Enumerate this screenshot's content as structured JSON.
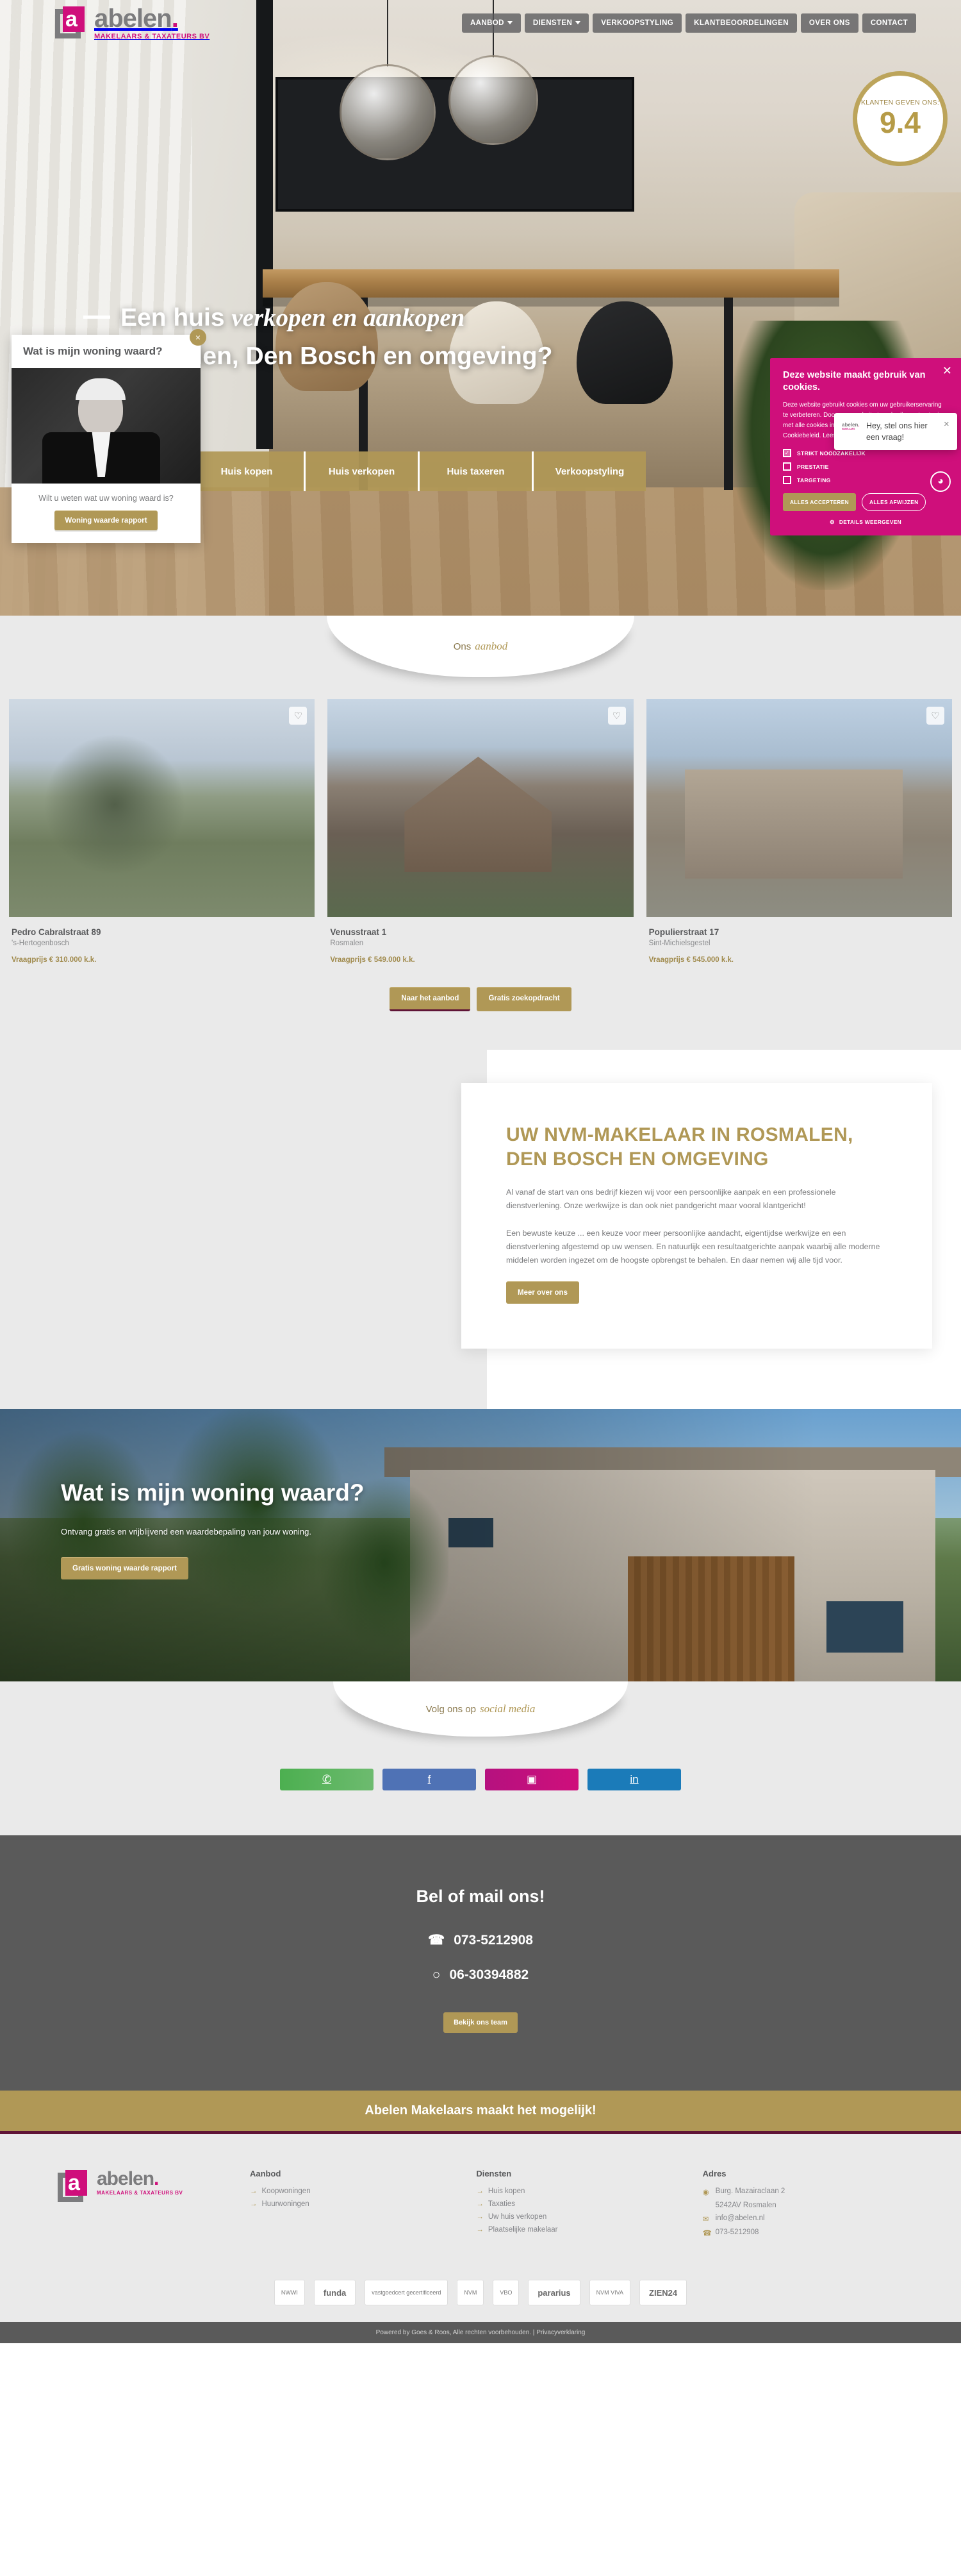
{
  "brand": {
    "name": "abelen",
    "dot": ".",
    "tagline": "MAKELAARS & TAXATEURS BV",
    "letter": "a",
    "colors": {
      "pink": "#cf0f7b",
      "gold": "#b09856",
      "grey": "#58595b",
      "dark_grey": "#5a5a5a",
      "wine": "#5f1436"
    }
  },
  "nav": {
    "items": [
      {
        "label": "AANBOD",
        "has_caret": true
      },
      {
        "label": "DIENSTEN",
        "has_caret": true
      },
      {
        "label": "VERKOOPSTYLING",
        "has_caret": false
      },
      {
        "label": "KLANTBEOORDELINGEN",
        "has_caret": false
      },
      {
        "label": "OVER ONS",
        "has_caret": false
      },
      {
        "label": "CONTACT",
        "has_caret": false
      }
    ]
  },
  "score_badge": {
    "label": "KLANTEN GEVEN ONS:",
    "value": "9.4"
  },
  "hero": {
    "line1_plain": "Een huis ",
    "line1_script": "verkopen en aankopen",
    "line2": "in Rosmalen, Den Bosch en omgeving?",
    "tabs": [
      {
        "label": "Huis kopen"
      },
      {
        "label": "Huis verkopen"
      },
      {
        "label": "Huis taxeren"
      },
      {
        "label": "Verkoopstyling"
      }
    ]
  },
  "value_card": {
    "heading": "Wat is mijn woning waard?",
    "question": "Wilt u weten wat uw woning waard is?",
    "button": "Woning waarde rapport",
    "close_icon": "×"
  },
  "cookie": {
    "title": "Deze website maakt gebruik van cookies.",
    "body": "Deze website gebruikt cookies om uw gebruikerservaring te verbeteren. Door onze website te gebruiken, stemt u in met alle cookies in overeenstemming met ons Cookiebeleid. Lees verder",
    "options": [
      {
        "label": "STRIKT NOODZAKELIJK",
        "checked": true
      },
      {
        "label": "PRESTATIE",
        "checked": false
      },
      {
        "label": "TARGETING",
        "checked": false
      }
    ],
    "accept": "ALLES ACCEPTEREN",
    "reject": "ALLES AFWIJZEN",
    "details": "DETAILS WEERGEVEN",
    "close_icon": "✕"
  },
  "chat": {
    "message": "Hey, stel ons hier een vraag!",
    "close_icon": "✕"
  },
  "offer": {
    "ribbon_plain": "Ons",
    "ribbon_script": "aanbod",
    "listings": [
      {
        "title": "Pedro Cabralstraat 89",
        "city": "'s-Hertogenbosch",
        "price": "Vraagprijs € 310.000 k.k."
      },
      {
        "title": "Venusstraat 1",
        "city": "Rosmalen",
        "price": "Vraagprijs € 549.000 k.k."
      },
      {
        "title": "Populierstraat 17",
        "city": "Sint-Michielsgestel",
        "price": "Vraagprijs € 545.000 k.k."
      }
    ],
    "buttons": [
      {
        "label": "Naar het aanbod"
      },
      {
        "label": "Gratis zoekopdracht"
      }
    ],
    "favorite_icon": "♡"
  },
  "about": {
    "heading": "UW NVM-MAKELAAR IN ROSMALEN, DEN BOSCH EN OMGEVING",
    "paragraph1": "Al vanaf de start van ons bedrijf kiezen wij voor een persoonlijke aanpak en een professionele dienstverlening. Onze werkwijze is dan ook niet pandgericht maar vooral klantgericht!",
    "paragraph2": "Een bewuste keuze ... een keuze voor meer persoonlijke aandacht, eigentijdse werkwijze en een dienstverlening afgestemd op uw wensen. En natuurlijk een resultaatgerichte aanpak waarbij alle moderne middelen worden ingezet om de hoogste opbrengst te behalen. En daar nemen wij alle tijd voor.",
    "button": "Meer over ons"
  },
  "value_banner": {
    "heading": "Wat is mijn woning waard?",
    "subtitle": "Ontvang gratis en vrijblijvend een waardebepaling van jouw woning.",
    "button": "Gratis woning waarde rapport"
  },
  "social": {
    "ribbon_plain": "Volg ons op",
    "ribbon_script": "social media",
    "items": [
      {
        "name": "whatsapp",
        "icon": "✆"
      },
      {
        "name": "facebook",
        "icon": "f"
      },
      {
        "name": "instagram",
        "icon": "▣"
      },
      {
        "name": "linkedin",
        "icon": "in"
      }
    ]
  },
  "contact": {
    "heading": "Bel of mail ons!",
    "phone": "073-5212908",
    "whatsapp": "06-30394882",
    "phone_icon": "☎",
    "whatsapp_icon": "○",
    "button": "Bekijk ons team"
  },
  "strip": {
    "text": "Abelen Makelaars maakt het mogelijk!"
  },
  "footer": {
    "columns": [
      {
        "title": "Aanbod",
        "links": [
          {
            "label": "Koopwoningen"
          },
          {
            "label": "Huurwoningen"
          }
        ]
      },
      {
        "title": "Diensten",
        "links": [
          {
            "label": "Huis kopen"
          },
          {
            "label": "Taxaties"
          },
          {
            "label": "Uw huis verkopen"
          },
          {
            "label": "Plaatselijke makelaar"
          }
        ]
      }
    ],
    "address": {
      "title": "Adres",
      "street": "Burg. Mazairaclaan 2",
      "postal": "5242AV Rosmalen",
      "email": "info@abelen.nl",
      "phone": "073-5212908",
      "pin_icon": "◉",
      "mail_icon": "✉",
      "phone_icon": "☎"
    },
    "arrow_icon": "→",
    "brands": [
      {
        "label": "NWWI",
        "style": "sm"
      },
      {
        "label": "funda",
        "style": "lg"
      },
      {
        "label": "vastgoedcert gecertificeerd",
        "style": "sm"
      },
      {
        "label": "NVM",
        "style": "sm"
      },
      {
        "label": "VBO",
        "style": "sm"
      },
      {
        "label": "pararius",
        "style": "lg"
      },
      {
        "label": "NVM VIVA",
        "style": "sm"
      },
      {
        "label": "ZIEN24",
        "style": "lg"
      }
    ],
    "copyright": "Powered by Goes & Roos, Alle rechten voorbehouden. |",
    "privacy": "Privacyverklaring"
  }
}
